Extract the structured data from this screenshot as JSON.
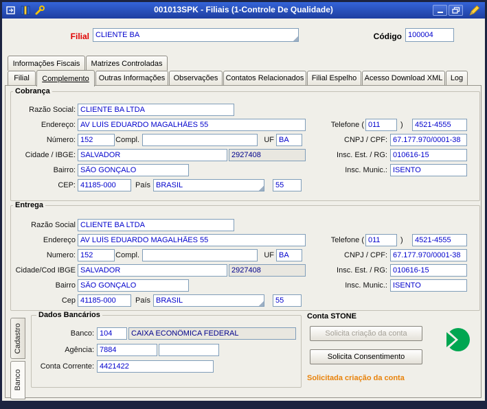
{
  "titlebar": {
    "title": "001013SPK - Filiais (1-Controle De Qualidade)"
  },
  "header": {
    "filial_label": "Filial",
    "filial_value": "CLIENTE BA",
    "codigo_label": "Código",
    "codigo_value": "100004"
  },
  "tabs": {
    "top": [
      "Informações Fiscais",
      "Matrizes Controladas"
    ],
    "main": [
      "Filial",
      "Complemento",
      "Outras Informações",
      "Observações",
      "Contatos Relacionados",
      "Filial Espelho",
      "Acesso Download XML",
      "Log"
    ],
    "active_main_tab": "Complemento",
    "active_side_tab": "Banco"
  },
  "cobranca": {
    "title": "Cobrança",
    "labels": {
      "razao_social": "Razão Social:",
      "endereco": "Endereço:",
      "numero": "Número:",
      "compl": "Compl.",
      "uf": "UF",
      "cidade": "Cidade / IBGE:",
      "bairro": "Bairro:",
      "cep": "CEP:",
      "pais": "País",
      "telefone_open": "Telefone (",
      "telefone_close": ")",
      "cnpj": "CNPJ / CPF:",
      "insc_est": "Insc. Est. / RG:",
      "insc_mun": "Insc. Munic.:"
    },
    "values": {
      "razao_social": "CLIENTE BA LTDA",
      "endereco": "AV LUÍS EDUARDO MAGALHÃES 55",
      "numero": "152",
      "compl": "",
      "uf": "BA",
      "cidade": "SALVADOR",
      "ibge": "2927408",
      "bairro": "SÃO GONÇALO",
      "cep": "41185-000",
      "pais": "BRASIL",
      "ddi": "55",
      "ddd": "011",
      "telefone": "4521-4555",
      "cnpj": "67.177.970/0001-38",
      "insc_est": "010616-15",
      "insc_mun": "ISENTO"
    }
  },
  "entrega": {
    "title": "Entrega",
    "labels": {
      "razao_social": "Razão Social",
      "endereco": "Endereço",
      "numero": "Numero:",
      "compl": "Compl.",
      "uf": "UF",
      "cidade": "Cidade/Cod IBGE",
      "bairro": "Bairro",
      "cep": "Cep",
      "pais": "País",
      "telefone_open": "Telefone (",
      "telefone_close": ")",
      "cnpj": "CNPJ / CPF:",
      "insc_est": "Insc. Est. / RG:",
      "insc_mun": "Insc. Munic.:"
    },
    "values": {
      "razao_social": "CLIENTE BA LTDA",
      "endereco": "AV LUÍS EDUARDO MAGALHÃES 55",
      "numero": "152",
      "compl": "",
      "uf": "BA",
      "cidade": "SALVADOR",
      "ibge": "2927408",
      "bairro": "SÃO GONÇALO",
      "cep": "41185-000",
      "pais": "BRASIL",
      "ddi": "55",
      "ddd": "011",
      "telefone": "4521-4555",
      "cnpj": "67.177.970/0001-38",
      "insc_est": "010616-15",
      "insc_mun": "ISENTO"
    }
  },
  "side_tabs": [
    "Cadastro",
    "Banco"
  ],
  "dados_bancarios": {
    "title": "Dados Bancários",
    "labels": {
      "banco": "Banco:",
      "agencia": "Agência:",
      "conta": "Conta Corrente:"
    },
    "values": {
      "banco_codigo": "104",
      "banco_nome": "CAIXA ECONÔMICA FEDERAL",
      "agencia": "7884",
      "agencia_compl": "",
      "conta": "4421422"
    }
  },
  "conta_stone": {
    "title": "Conta STONE",
    "buttons": {
      "criacao": "Solicita criação da conta",
      "consentimento": "Solicita Consentimento"
    },
    "status": "Solicitada criação da conta"
  },
  "colors": {
    "field_text": "#0000cc",
    "readonly_text": "#00008b",
    "filial_red": "#e00000",
    "status_orange": "#e8820a",
    "stone_green": "#00a651",
    "titlebar_top": "#3464d8",
    "titlebar_bottom": "#1e3ea0",
    "frame_navy": "#1c2340"
  }
}
